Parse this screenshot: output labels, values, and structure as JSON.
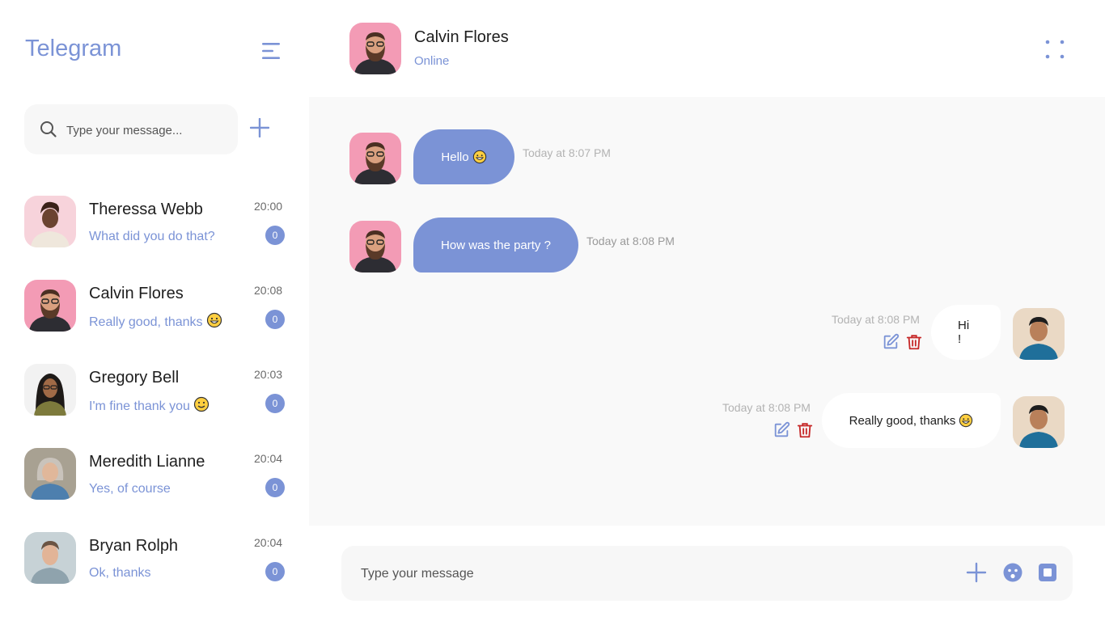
{
  "app": {
    "title": "Telegram"
  },
  "search": {
    "placeholder": "Type your message..."
  },
  "contacts": [
    {
      "name": "Theressa Webb",
      "preview": "What did you do that?",
      "time": "20:00",
      "unread": "0",
      "emoji": ""
    },
    {
      "name": "Calvin Flores",
      "preview": "Really good, thanks",
      "time": "20:08",
      "unread": "0",
      "emoji": "grinning"
    },
    {
      "name": "Gregory Bell",
      "preview": "I'm fine thank you",
      "time": "20:03",
      "unread": "0",
      "emoji": "smile"
    },
    {
      "name": "Meredith Lianne",
      "preview": "Yes, of course",
      "time": "20:04",
      "unread": "0",
      "emoji": ""
    },
    {
      "name": "Bryan Rolph",
      "preview": "Ok, thanks",
      "time": "20:04",
      "unread": "0",
      "emoji": ""
    }
  ],
  "chat": {
    "name": "Calvin Flores",
    "status": "Online",
    "messages": [
      {
        "direction": "incoming",
        "text": "Hello",
        "emoji": "grin",
        "time": "Today at 8:07 PM"
      },
      {
        "direction": "incoming",
        "text": "How was the party ?",
        "emoji": "",
        "time": "Today at 8:08 PM"
      },
      {
        "direction": "outgoing",
        "text": "Hi !",
        "emoji": "",
        "time": "Today at 8:08 PM"
      },
      {
        "direction": "outgoing",
        "text": "Really good, thanks",
        "emoji": "grinning",
        "time": "Today at 8:08 PM"
      }
    ]
  },
  "composer": {
    "placeholder": "Type your message"
  },
  "icons": {
    "menu": "menu-icon",
    "search": "search-icon",
    "add": "plus-icon",
    "more": "dots-grid-icon",
    "edit": "edit-icon",
    "delete": "trash-icon",
    "emoji": "emoji-icon",
    "attach": "image-icon"
  },
  "colors": {
    "accent": "#7b93d6",
    "delete": "#c62828",
    "body_bg": "#f9f9f9",
    "input_bg": "#f7f7f7"
  }
}
